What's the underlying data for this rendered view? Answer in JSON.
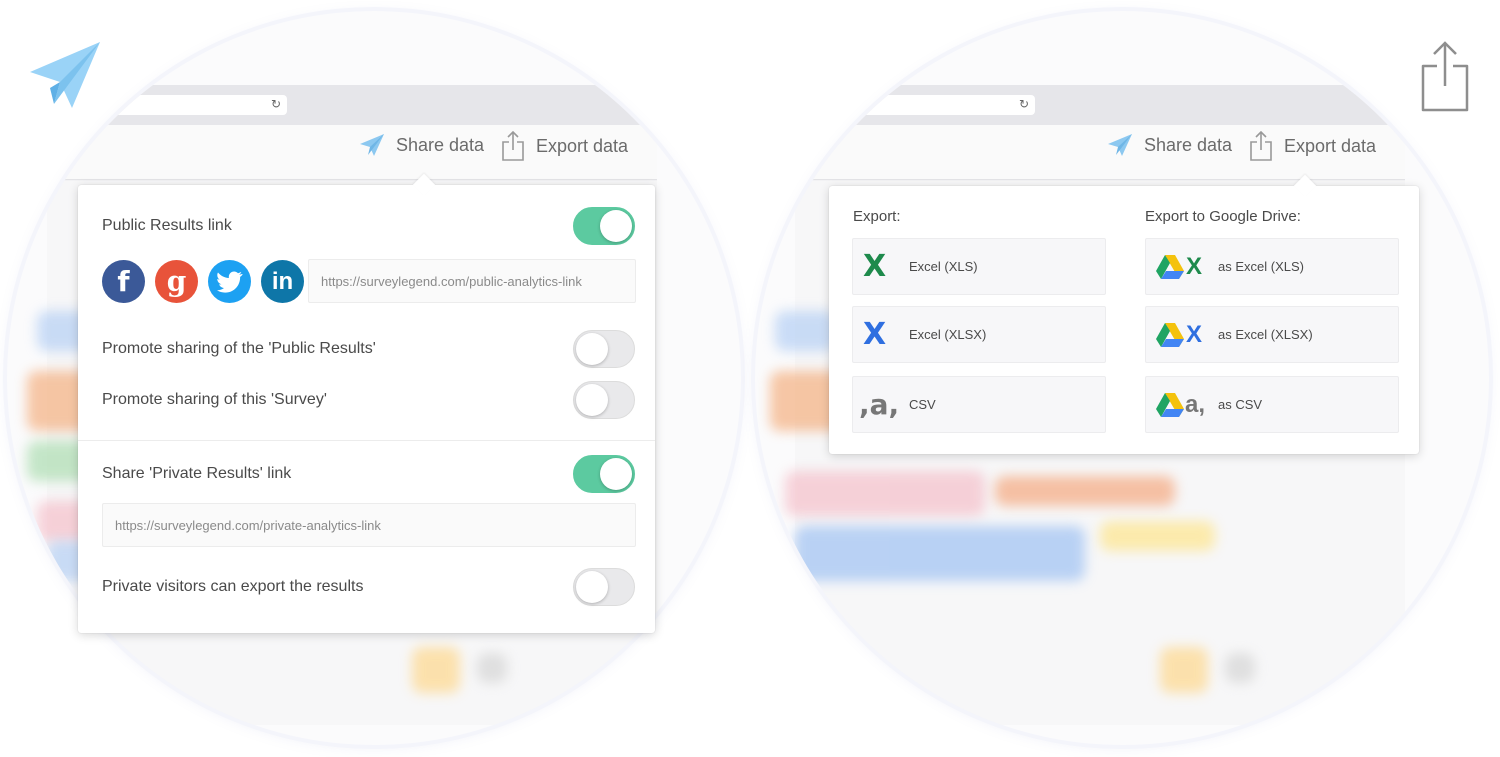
{
  "header": {
    "share_label": "Share data",
    "export_label": "Export data"
  },
  "share_popover": {
    "public_link": {
      "label": "Public Results link",
      "enabled": true
    },
    "social": [
      {
        "name": "facebook",
        "glyph": "f",
        "color": "#3b5998"
      },
      {
        "name": "google",
        "glyph": "g",
        "color": "#e8533a"
      },
      {
        "name": "twitter",
        "glyph": "t",
        "color": "#1da1f2"
      },
      {
        "name": "linkedin",
        "glyph": "in",
        "color": "#0e76a8"
      }
    ],
    "public_url": "https://surveylegend.com/public-analytics-link",
    "promote_results": {
      "label": "Promote sharing of the 'Public Results'",
      "enabled": false
    },
    "promote_survey": {
      "label": "Promote sharing of this 'Survey'",
      "enabled": false
    },
    "private_link": {
      "label": "Share 'Private Results' link",
      "enabled": true
    },
    "private_url": "https://surveylegend.com/private-analytics-link",
    "private_export": {
      "label": "Private visitors can export the results",
      "enabled": false
    }
  },
  "export_popover": {
    "local_title": "Export:",
    "drive_title": "Export to Google Drive:",
    "local": [
      {
        "label": "Excel (XLS)",
        "icon": "excel-xls-icon",
        "color": "#1e8a4c"
      },
      {
        "label": "Excel (XLSX)",
        "icon": "excel-xlsx-icon",
        "color": "#2f6fe0"
      },
      {
        "label": "CSV",
        "icon": "csv-icon",
        "glyph": ",a,",
        "color": "#777777"
      }
    ],
    "drive": [
      {
        "label": "as Excel (XLS)",
        "icon": "drive-xls-icon",
        "color": "#1e8a4c"
      },
      {
        "label": "as Excel (XLSX)",
        "icon": "drive-xlsx-icon",
        "color": "#2f6fe0"
      },
      {
        "label": "as CSV",
        "icon": "drive-csv-icon",
        "glyph": "a,",
        "color": "#777777"
      }
    ]
  },
  "colors": {
    "toggle_on": "#5ccaa0",
    "share_icon": "#8cc8f0",
    "export_icon": "#999999"
  }
}
